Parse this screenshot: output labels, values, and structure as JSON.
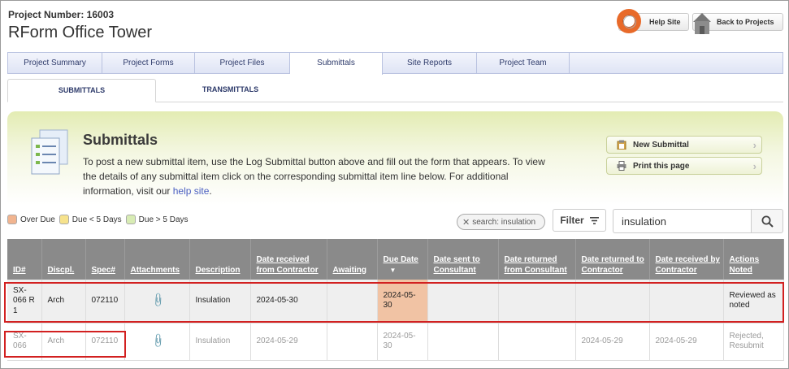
{
  "project": {
    "number_label": "Project Number: 16003",
    "name": "RForm Office Tower"
  },
  "header_buttons": {
    "help": "Help Site",
    "back": "Back to Projects"
  },
  "tabs": [
    {
      "label": "Project Summary"
    },
    {
      "label": "Project Forms"
    },
    {
      "label": "Project Files"
    },
    {
      "label": "Submittals"
    },
    {
      "label": "Site Reports"
    },
    {
      "label": "Project Team"
    }
  ],
  "subtabs": [
    {
      "label": "SUBMITTALS"
    },
    {
      "label": "TRANSMITTALS"
    }
  ],
  "banner": {
    "title": "Submittals",
    "text": "To post a new submittal item, use the Log Submittal button above and fill out the form that appears. To view the details of any submittal item click on the corresponding submittal item line below. For additional information, visit our ",
    "link": "help site",
    "text_end": ".",
    "new_submittal": "New Submittal",
    "print_page": "Print this page"
  },
  "legend": {
    "over_due": "Over Due",
    "due_lt5": "Due < 5 Days",
    "due_gt5": "Due > 5 Days",
    "colors": {
      "over_due": "#f1b48f",
      "due_lt5": "#f6e28c",
      "due_gt5": "#d8ecb4"
    }
  },
  "search": {
    "chip": "search: insulation",
    "filter": "Filter",
    "value": "insulation"
  },
  "table": {
    "headers": {
      "id": "ID#",
      "discipline": "Discpl.",
      "spec": "Spec#",
      "attachments": "Attachments",
      "description": "Description",
      "date_received_from_contractor": "Date received from Contractor",
      "awaiting": "Awaiting",
      "due_date": "Due Date",
      "date_sent_to_consultant": "Date sent to Consultant",
      "date_returned_from_consultant": "Date returned from Consultant",
      "date_returned_to_contractor": "Date returned to Contractor",
      "date_received_by_contractor": "Date received by Contractor",
      "actions_noted": "Actions Noted"
    },
    "rows": [
      {
        "id": "SX-066 R 1",
        "discipline": "Arch",
        "spec": "072110",
        "description": "Insulation",
        "date_received_from_contractor": "2024-05-30",
        "awaiting": "",
        "due_date": "2024-05-30",
        "date_sent_to_consultant": "",
        "date_returned_from_consultant": "",
        "date_returned_to_contractor": "",
        "date_received_by_contractor": "",
        "actions_noted": "Reviewed as noted"
      },
      {
        "id": "SX-066",
        "discipline": "Arch",
        "spec": "072110",
        "description": "Insulation",
        "date_received_from_contractor": "2024-05-29",
        "awaiting": "",
        "due_date": "2024-05-30",
        "date_sent_to_consultant": "",
        "date_returned_from_consultant": "",
        "date_returned_to_contractor": "2024-05-29",
        "date_received_by_contractor": "2024-05-29",
        "actions_noted": "Rejected, Resubmit"
      }
    ]
  }
}
